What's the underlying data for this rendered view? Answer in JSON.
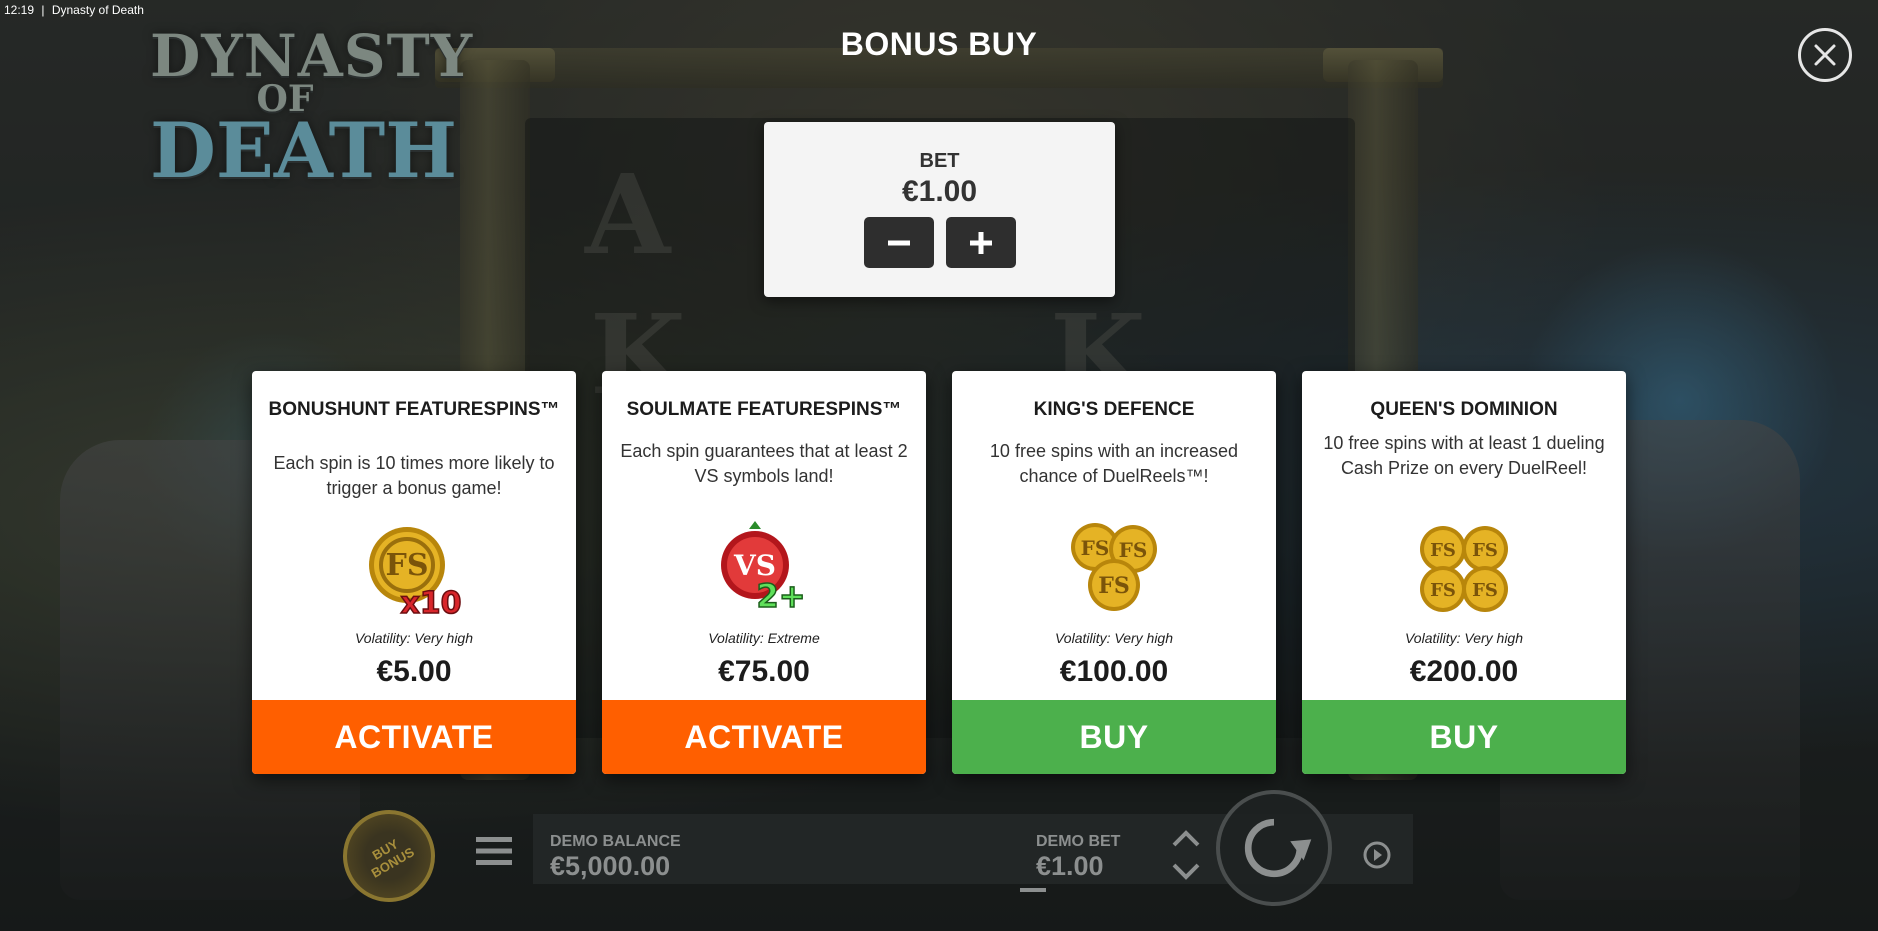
{
  "status_bar": {
    "time": "12:19",
    "separator": "|",
    "app_title": "Dynasty of Death"
  },
  "logo": {
    "line1": "DYNASTY",
    "line2": "OF",
    "line3": "DEATH"
  },
  "page_title": "BONUS BUY",
  "close_icon": "close-icon",
  "bet_panel": {
    "label": "BET",
    "value": "€1.00",
    "decrease_icon": "minus-icon",
    "increase_icon": "plus-icon"
  },
  "cards": [
    {
      "title": "BONUSHUNT FEATURESPINS™",
      "description": "Each spin is 10 times more likely to trigger a bonus game!",
      "icon": "fs-coin-x10-icon",
      "icon_text": "x10",
      "volatility": "Volatility: Very high",
      "price": "€5.00",
      "action": "ACTIVATE",
      "action_color": "#ff5f00"
    },
    {
      "title": "SOULMATE FEATURESPINS™",
      "description": "Each spin guarantees that at least 2 VS symbols land!",
      "icon": "vs-symbol-2plus-icon",
      "icon_text": "2+",
      "volatility": "Volatility: Extreme",
      "price": "€75.00",
      "action": "ACTIVATE",
      "action_color": "#ff5f00"
    },
    {
      "title": "KING'S DEFENCE",
      "description": "10 free spins with an increased chance of DuelReels™!",
      "icon": "three-fs-coins-icon",
      "volatility": "Volatility: Very high",
      "price": "€100.00",
      "action": "BUY",
      "action_color": "#4cb04c"
    },
    {
      "title": "QUEEN'S DOMINION",
      "description": "10 free spins with at least 1 dueling Cash Prize on every DuelReel!",
      "icon": "four-fs-coins-icon",
      "volatility": "Volatility: Very high",
      "price": "€200.00",
      "action": "BUY",
      "action_color": "#4cb04c"
    }
  ],
  "bottom_bar": {
    "buy_bonus_label": "BUY BONUS",
    "demo_balance_label": "DEMO BALANCE",
    "demo_balance_value": "€5,000.00",
    "demo_bet_label": "DEMO BET",
    "demo_bet_value": "€1.00"
  },
  "colors": {
    "activate": "#ff5f00",
    "buy": "#4cb04c",
    "coin_gold": "#e5b325",
    "card_bg": "#ffffff"
  }
}
